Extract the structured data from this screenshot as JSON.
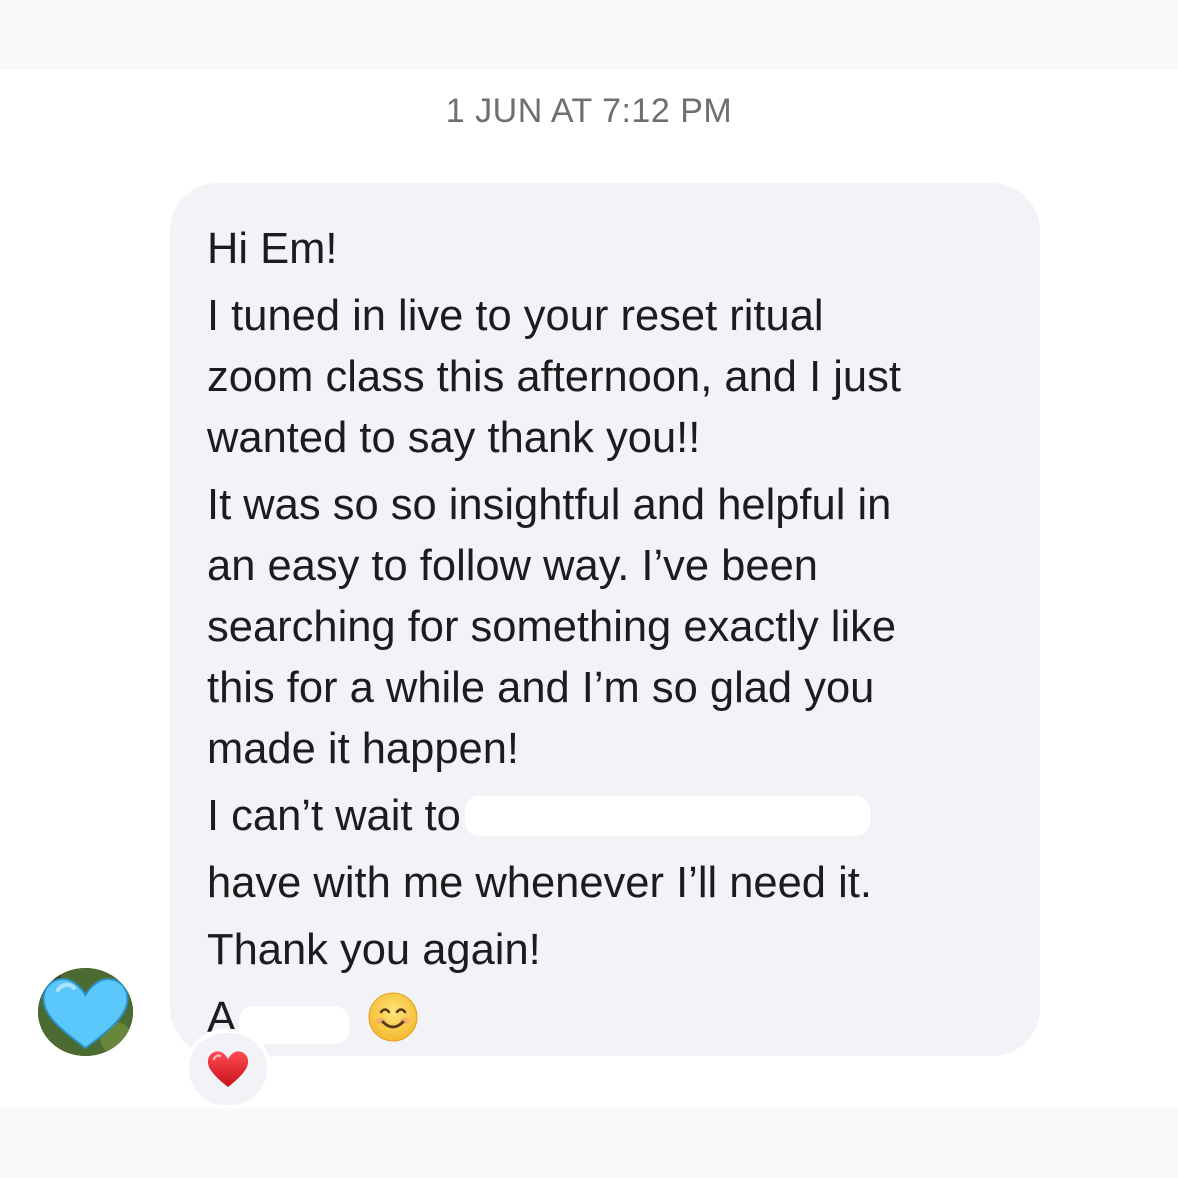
{
  "timestamp": "1 JUN AT 7:12 PM",
  "message": {
    "greeting": "Hi Em!",
    "para1": [
      "I tuned in live to your reset ritual",
      "zoom class this afternoon, and I just",
      "wanted to say thank you!!"
    ],
    "para2": [
      "It was so so insightful and helpful in",
      "an easy to follow way. I’ve been",
      "searching for something exactly like",
      "this for a while and I’m so glad you",
      "made it happen!"
    ],
    "para3_start": "I can’t wait to",
    "para3_end": "have with me whenever I’ll need it.",
    "thanks": "Thank you again!",
    "signature_initial": "A",
    "emoji": "smiling-face-emoji"
  },
  "sender_avatar": {
    "icon": "light-blue-heart",
    "accent": "#5ac8fa"
  },
  "reaction": {
    "icon": "red-heart",
    "color": "#e5242f"
  },
  "colors": {
    "bubble": "#f2f3f6",
    "text": "#1c1c1e",
    "timestamp": "#6e6e73"
  }
}
